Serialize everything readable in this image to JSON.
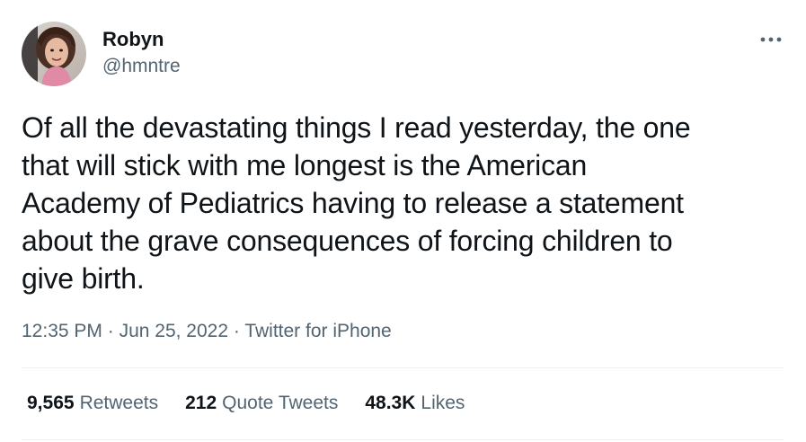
{
  "author": {
    "display_name": "Robyn",
    "handle": "@hmntre"
  },
  "icons": {
    "more": "more-horizontal-icon",
    "avatar": "profile-photo"
  },
  "tweet": {
    "text_lines": [
      "Of all the devastating things I read yesterday, the one",
      "that will stick with me longest is the American",
      "Academy of Pediatrics having to release a statement",
      "about the grave consequences of forcing children to",
      "give birth."
    ],
    "time": "12:35 PM",
    "separator": "·",
    "date": "Jun 25, 2022",
    "source": "Twitter for iPhone"
  },
  "stats": {
    "retweets_count": "9,565",
    "retweets_label": "Retweets",
    "quotes_count": "212",
    "quotes_label": "Quote Tweets",
    "likes_count": "48.3K",
    "likes_label": "Likes"
  },
  "colors": {
    "primary_text": "#0f1419",
    "secondary_text": "#536471",
    "divider": "#eff3f4"
  }
}
